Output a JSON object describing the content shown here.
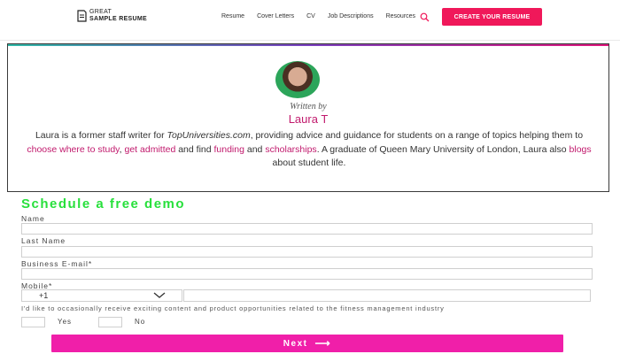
{
  "header": {
    "logo_line1": "GREAT",
    "logo_line2": "SAMPLE RESUME",
    "nav": [
      "Resume",
      "Cover Letters",
      "CV",
      "Job Descriptions",
      "Resources"
    ],
    "cta_label": "CREATE YOUR RESUME"
  },
  "author": {
    "written_by": "Written by",
    "name": "Laura T",
    "bio": {
      "t1": "Laura is a former staff writer for ",
      "site": "TopUniversities.com",
      "t2": ", providing advice and guidance for students on a range of topics helping them to ",
      "link1": "choose where to study",
      "t3": ", ",
      "link2": "get admitted",
      "t4": " and find ",
      "link3": "funding",
      "t5": " and ",
      "link4": "scholarships",
      "t6": ". A graduate of Queen Mary University of London, Laura also ",
      "link5": "blogs",
      "t7": " about student life."
    }
  },
  "form": {
    "title": "Schedule a free demo",
    "name_label": "Name",
    "last_name_label": "Last Name",
    "email_label": "Business E-mail*",
    "mobile_label": "Mobile*",
    "country_code": "+1",
    "consent_text": "I'd like to occasionally receive exciting content and product opportunities related to the fitness management industry",
    "yes_label": "Yes",
    "no_label": "No",
    "next_label": "Next",
    "next_arrow": "⟶"
  },
  "colors": {
    "brand_pink": "#f0185a",
    "link_magenta": "#c11a6d",
    "title_green": "#28e03c",
    "next_button": "#f01fa9"
  }
}
